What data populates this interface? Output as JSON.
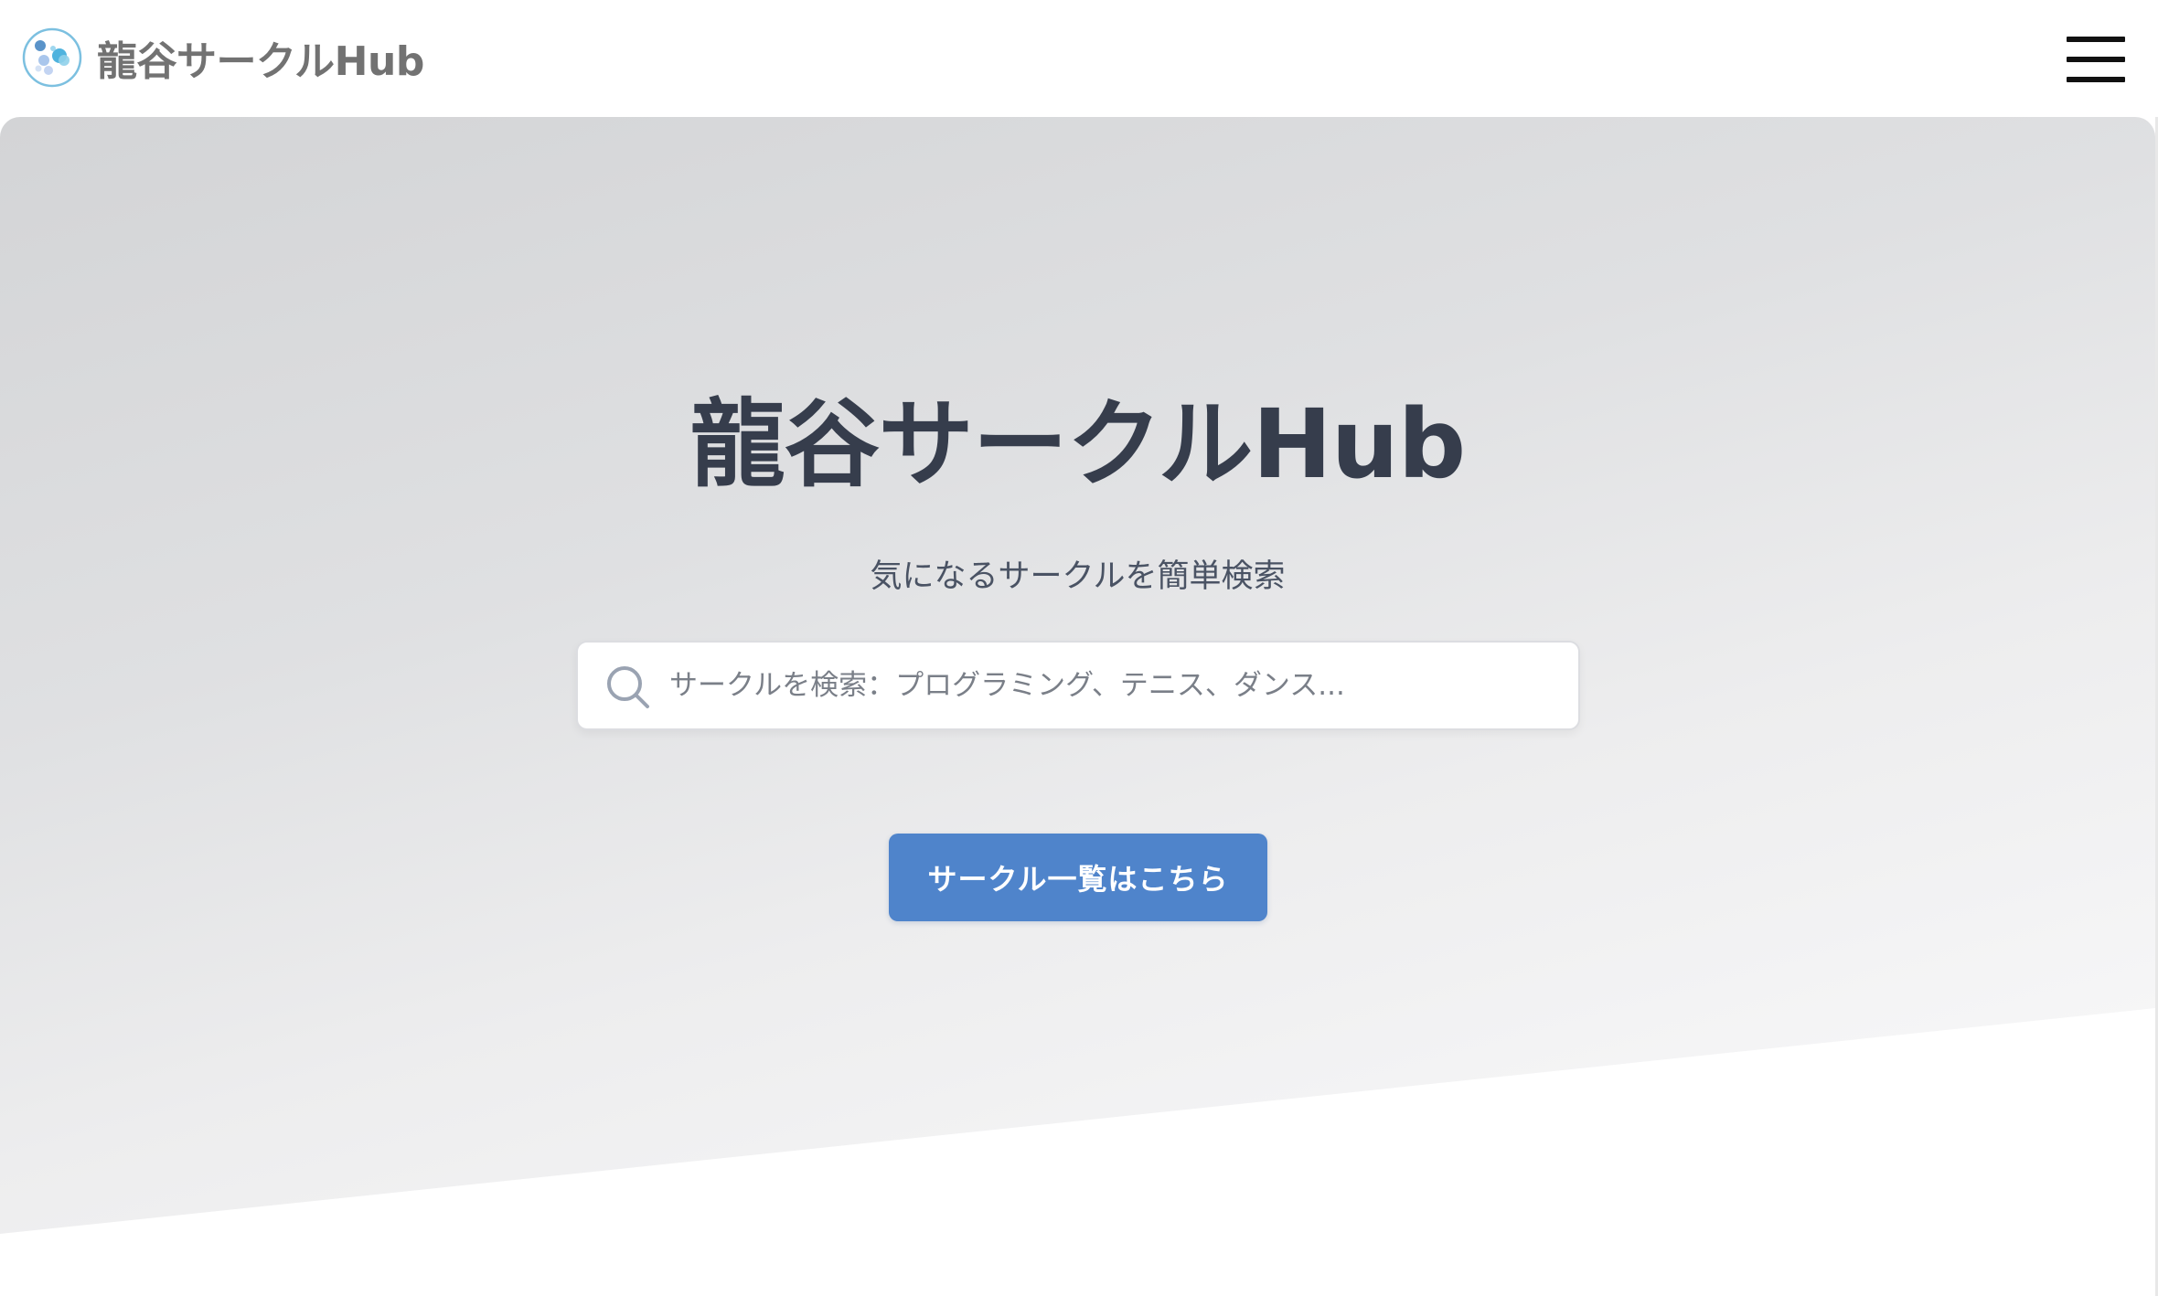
{
  "header": {
    "brand_name": "龍谷サークルHub",
    "logo_icon": "bubbles-logo-icon",
    "menu_icon": "hamburger-menu-icon"
  },
  "hero": {
    "title": "龍谷サークルHub",
    "subtitle": "気になるサークルを簡単検索"
  },
  "search": {
    "icon": "search-icon",
    "placeholder": "サークルを検索：プログラミング、テニス、ダンス...",
    "value": ""
  },
  "cta": {
    "label": "サークル一覧はこちら"
  },
  "colors": {
    "accent": "#4f84cb",
    "title_text": "#363d4c",
    "brand_text": "#727272",
    "logo_blue": "#5fb0dc"
  }
}
